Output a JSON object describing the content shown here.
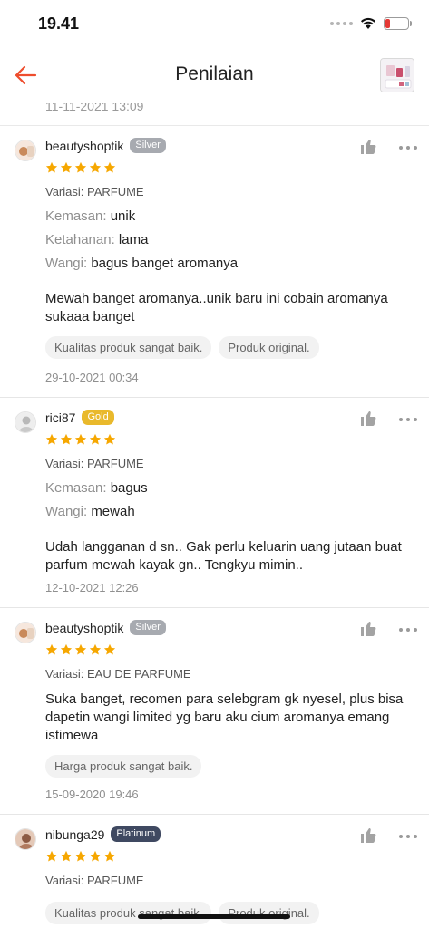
{
  "status_bar": {
    "time": "19.41",
    "battery_level": 0.2,
    "battery_color": "#e53935"
  },
  "header": {
    "title": "Penilaian",
    "back_icon": "arrow-left-icon",
    "accent_color": "#ee4d2d"
  },
  "previous_review": {
    "date": "11-11-2021 13:09"
  },
  "reviews": [
    {
      "username": "beautyshoptik",
      "badge": "Silver",
      "rating": 5,
      "variant": "Variasi: PARFUME",
      "attributes": [
        {
          "key": "Kemasan:",
          "value": "unik"
        },
        {
          "key": "Ketahanan:",
          "value": "lama"
        },
        {
          "key": "Wangi:",
          "value": "bagus banget aromanya"
        }
      ],
      "text": "Mewah banget aromanya..unik baru ini cobain aromanya sukaaa banget",
      "tags": [
        "Kualitas produk sangat baik.",
        "Produk original."
      ],
      "date": "29-10-2021 00:34"
    },
    {
      "username": "rici87",
      "badge": "Gold",
      "rating": 5,
      "variant": "Variasi: PARFUME",
      "attributes": [
        {
          "key": "Kemasan:",
          "value": "bagus"
        },
        {
          "key": "Wangi:",
          "value": "mewah"
        }
      ],
      "text": "Udah langganan d sn.. Gak perlu keluarin uang jutaan buat parfum mewah kayak gn.. Tengkyu mimin..",
      "tags": [],
      "date": "12-10-2021 12:26"
    },
    {
      "username": "beautyshoptik",
      "badge": "Silver",
      "rating": 5,
      "variant": "Variasi: EAU DE PARFUME",
      "attributes": [],
      "text": "Suka banget, recomen para selebgram gk nyesel, plus bisa dapetin wangi limited yg baru aku cium aromanya emang istimewa",
      "tags": [
        "Harga produk sangat baik."
      ],
      "date": "15-09-2020 19:46"
    },
    {
      "username": "nibunga29",
      "badge": "Platinum",
      "rating": 5,
      "variant": "Variasi: PARFUME",
      "attributes": [],
      "text": "",
      "tags": [
        "Kualitas produk sangat baik.",
        "Produk original."
      ],
      "date": ""
    }
  ],
  "colors": {
    "star": "#f6a700",
    "badge_silver": "#a7aab0",
    "badge_gold": "#e9b92c",
    "badge_platinum": "#3f4961"
  },
  "icons": {
    "like": "thumbs-up-icon",
    "more": "more-horizontal-icon",
    "star": "star-icon",
    "wifi": "wifi-icon",
    "battery": "battery-icon"
  }
}
